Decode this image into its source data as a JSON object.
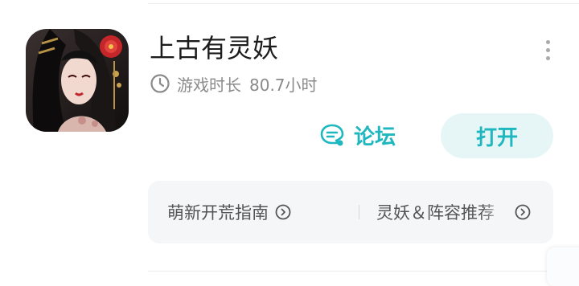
{
  "game": {
    "title": "上古有灵妖",
    "playtime_label": "游戏时长",
    "playtime_value": "80.7小时"
  },
  "actions": {
    "forum_label": "论坛",
    "open_label": "打开"
  },
  "guides": [
    {
      "label": "萌新开荒指南"
    },
    {
      "label": "灵妖＆阵容推荐"
    }
  ],
  "icons": {
    "clock": "clock-icon",
    "forum": "chat-bubble-icon",
    "more": "more-vertical-icon",
    "guide_arrow": "chevron-right-circle-icon"
  },
  "colors": {
    "accent": "#1fb7bf",
    "accent_bg": "#e6f6f7",
    "muted_text": "#8a8a8a",
    "card_bg": "#f5f6f8"
  }
}
